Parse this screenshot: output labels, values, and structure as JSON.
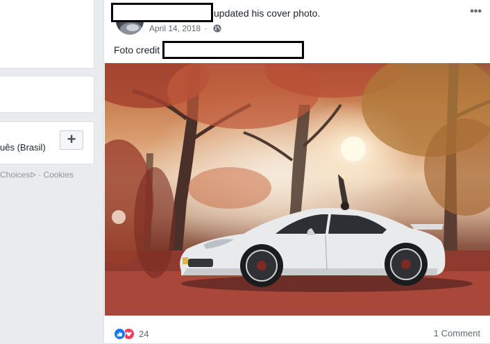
{
  "left_column": {
    "language_text": "uês (Brasil)",
    "add_language_label": "+",
    "footer": {
      "ad_choices": "Choices",
      "separator": "·",
      "cookies": "Cookies"
    }
  },
  "post": {
    "action_text": "updated his cover photo.",
    "date": "April 14, 2018",
    "meta_separator": "·",
    "audience_icon": "globe-icon",
    "more_label": "•••",
    "text_prefix": "Foto credit",
    "reaction_count": "24",
    "comment_count": "1 Comment",
    "reaction_icons": [
      "like-icon",
      "love-icon"
    ],
    "colors": {
      "like": "#1877f2",
      "love": "#f33e58",
      "meta": "#616770"
    }
  }
}
